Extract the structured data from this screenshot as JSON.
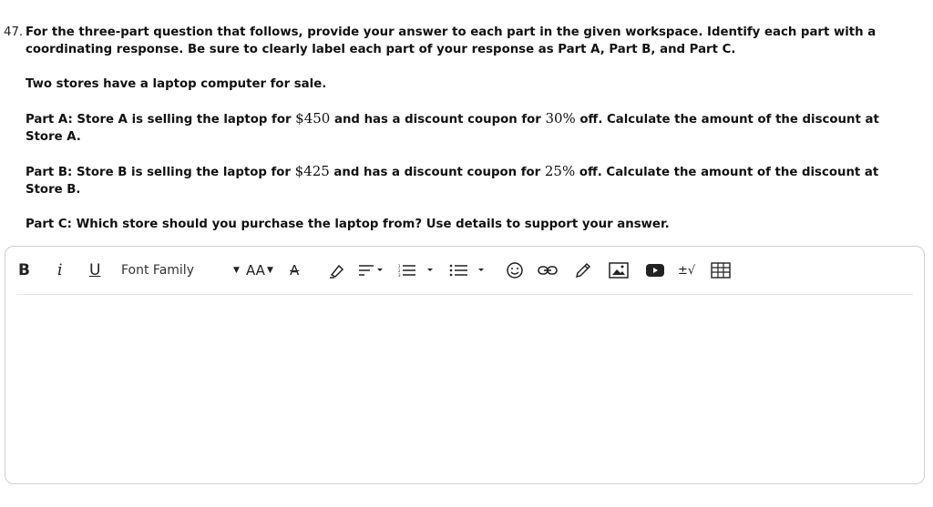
{
  "question": {
    "number": "47.",
    "instruction": "For the three-part question that follows, provide your answer to each part in the given workspace. Identify each part with a coordinating response. Be sure to clearly label each part of your response as Part A, Part B, and Part C.",
    "intro": "Two stores have a laptop computer for sale.",
    "part_a": {
      "pre": "Part A: Store A is selling the laptop for ",
      "price": "$450",
      "mid": " and has a discount coupon for ",
      "percent": "30%",
      "post": " off. Calculate the amount of the discount at Store A."
    },
    "part_b": {
      "pre": "Part B: Store B is selling the laptop for ",
      "price": "$425",
      "mid": " and has a discount coupon for ",
      "percent": "25%",
      "post": " off. Calculate the amount of the discount at Store B."
    },
    "part_c": "Part C: Which store should you purchase the laptop from? Use details to support your answer."
  },
  "toolbar": {
    "bold": "B",
    "italic": "i",
    "underline": "U",
    "font_family": "Font Family",
    "font_size": "AA",
    "text_color": "A",
    "math": "±√"
  },
  "icons": [
    "chevron-down-icon",
    "font-size-icon",
    "text-color-icon",
    "highlight-icon",
    "align-icon",
    "ordered-list-icon",
    "bullet-list-icon",
    "emoji-icon",
    "link-icon",
    "draw-icon",
    "image-icon",
    "video-icon",
    "math-icon",
    "table-icon"
  ]
}
